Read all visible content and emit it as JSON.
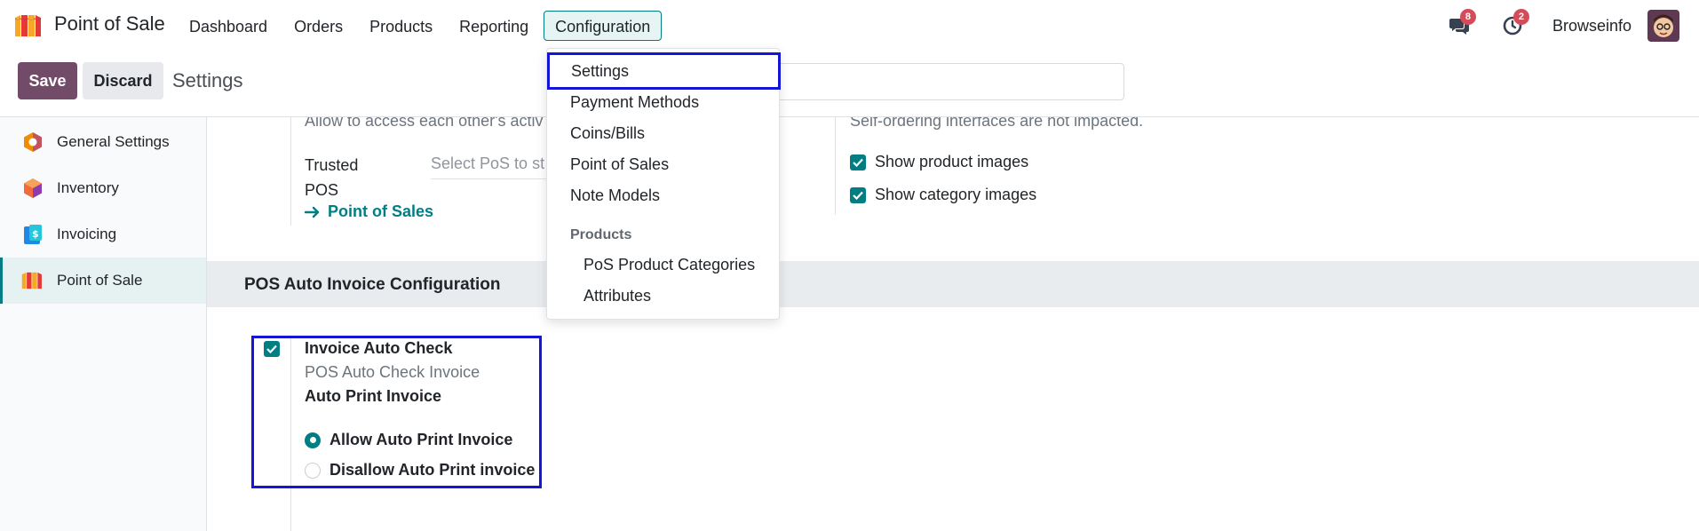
{
  "app": {
    "name": "Point of Sale",
    "logo_icon": "pos-stall-icon"
  },
  "nav": {
    "items": [
      {
        "label": "Dashboard"
      },
      {
        "label": "Orders"
      },
      {
        "label": "Products"
      },
      {
        "label": "Reporting"
      },
      {
        "label": "Configuration"
      }
    ],
    "active": "Configuration"
  },
  "systray": {
    "messages_count": "8",
    "activities_count": "2",
    "user_name": "Browseinfo"
  },
  "control_panel": {
    "save_label": "Save",
    "discard_label": "Discard",
    "title": "Settings"
  },
  "sidebar": {
    "items": [
      {
        "label": "General Settings",
        "icon": "settings-hexagon-icon"
      },
      {
        "label": "Inventory",
        "icon": "inventory-box-icon"
      },
      {
        "label": "Invoicing",
        "icon": "invoice-icon"
      },
      {
        "label": "Point of Sale",
        "icon": "pos-stall-icon"
      }
    ],
    "active": "Point of Sale"
  },
  "content": {
    "cut_left_text": "Allow to access each other's activ",
    "cut_right_text": "Self-ordering interfaces are not impacted.",
    "trusted_label_line1": "Trusted",
    "trusted_label_line2": "POS",
    "trusted_placeholder": "Select PoS to st",
    "pos_link_label": "Point of Sales",
    "show_product_images": "Show product images",
    "show_category_images": "Show category images",
    "section_title": "POS Auto Invoice Configuration",
    "invoice_auto_check": "Invoice Auto Check",
    "invoice_auto_check_help": "POS Auto Check Invoice",
    "auto_print_invoice": "Auto Print Invoice",
    "radio_options": [
      {
        "label": "Allow Auto Print Invoice",
        "selected": true
      },
      {
        "label": "Disallow Auto Print invoice",
        "selected": false
      }
    ]
  },
  "dropdown": {
    "items": [
      {
        "label": "Settings",
        "highlighted": true
      },
      {
        "label": "Payment Methods"
      },
      {
        "label": "Coins/Bills"
      },
      {
        "label": "Point of Sales"
      },
      {
        "label": "Note Models"
      }
    ],
    "group_header": "Products",
    "group_items": [
      {
        "label": "PoS Product Categories"
      },
      {
        "label": "Attributes"
      }
    ]
  },
  "colors": {
    "primary": "#714b67",
    "accent": "#017e84",
    "badge": "#d44c59",
    "highlight_box": "#1515d8"
  }
}
